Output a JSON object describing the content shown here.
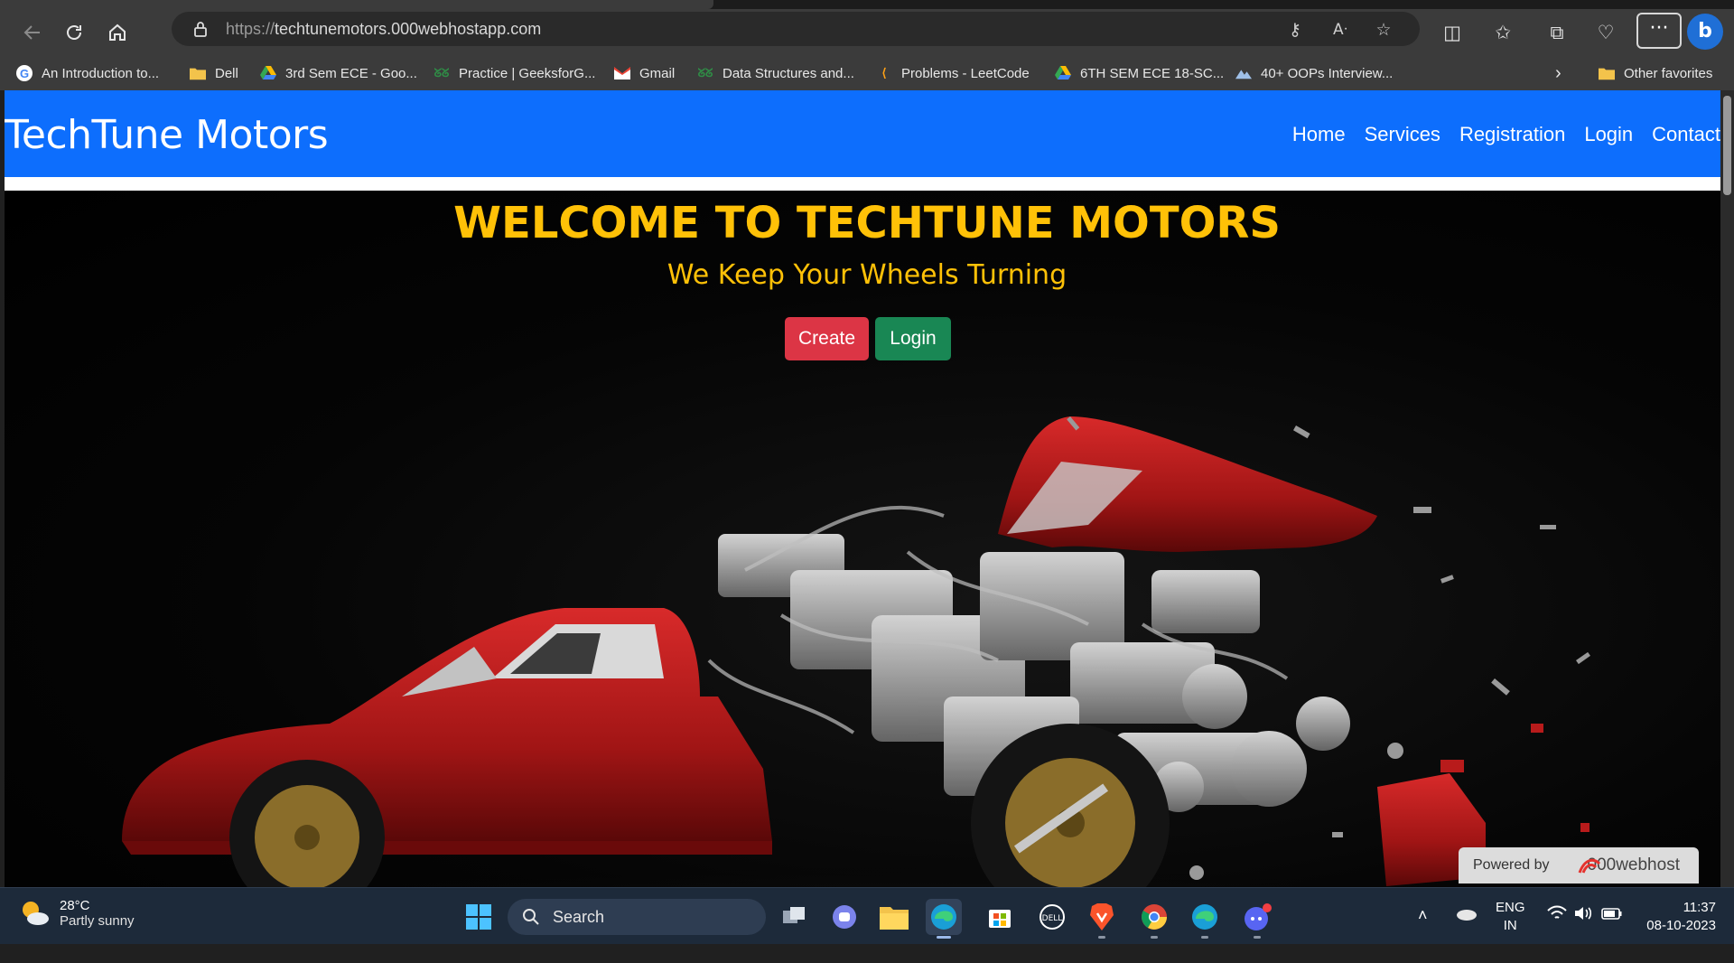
{
  "browser": {
    "url_scheme": "https://",
    "url_host": "techtunemotors.000webhostapp.com",
    "favorites": [
      {
        "label": "An Introduction to...",
        "icon": "google-icon"
      },
      {
        "label": "Dell",
        "icon": "folder-icon"
      },
      {
        "label": "3rd Sem ECE - Goo...",
        "icon": "google-drive-icon"
      },
      {
        "label": "Practice | GeeksforG...",
        "icon": "geeksforgeeks-icon"
      },
      {
        "label": "Gmail",
        "icon": "gmail-icon"
      },
      {
        "label": "Data Structures and...",
        "icon": "geeksforgeeks-icon"
      },
      {
        "label": "Problems - LeetCode",
        "icon": "leetcode-icon"
      },
      {
        "label": "6TH SEM ECE 18-SC...",
        "icon": "google-drive-icon"
      },
      {
        "label": "40+ OOPs Interview...",
        "icon": "interviewbit-icon"
      }
    ],
    "other_favorites": "Other favorites",
    "more_label": "···",
    "bing_label": "b"
  },
  "site": {
    "brand": "TechTune Motors",
    "nav": [
      "Home",
      "Services",
      "Registration",
      "Login",
      "Contact"
    ],
    "hero_title": "WELCOME TO TECHTUNE MOTORS",
    "hero_subtitle": "We Keep Your Wheels Turning",
    "create_label": "Create",
    "login_label": "Login",
    "powered_by": "Powered by",
    "powered_brand": "000webhost"
  },
  "taskbar": {
    "weather_temp": "28°C",
    "weather_desc": "Partly sunny",
    "search_label": "Search",
    "lang_top": "ENG",
    "lang_bottom": "IN",
    "time": "11:37",
    "date": "08-10-2023"
  },
  "colors": {
    "navbar": "#0d6efd",
    "hero_text": "#ffc107",
    "create_button": "#dc3545",
    "login_button": "#198754"
  }
}
